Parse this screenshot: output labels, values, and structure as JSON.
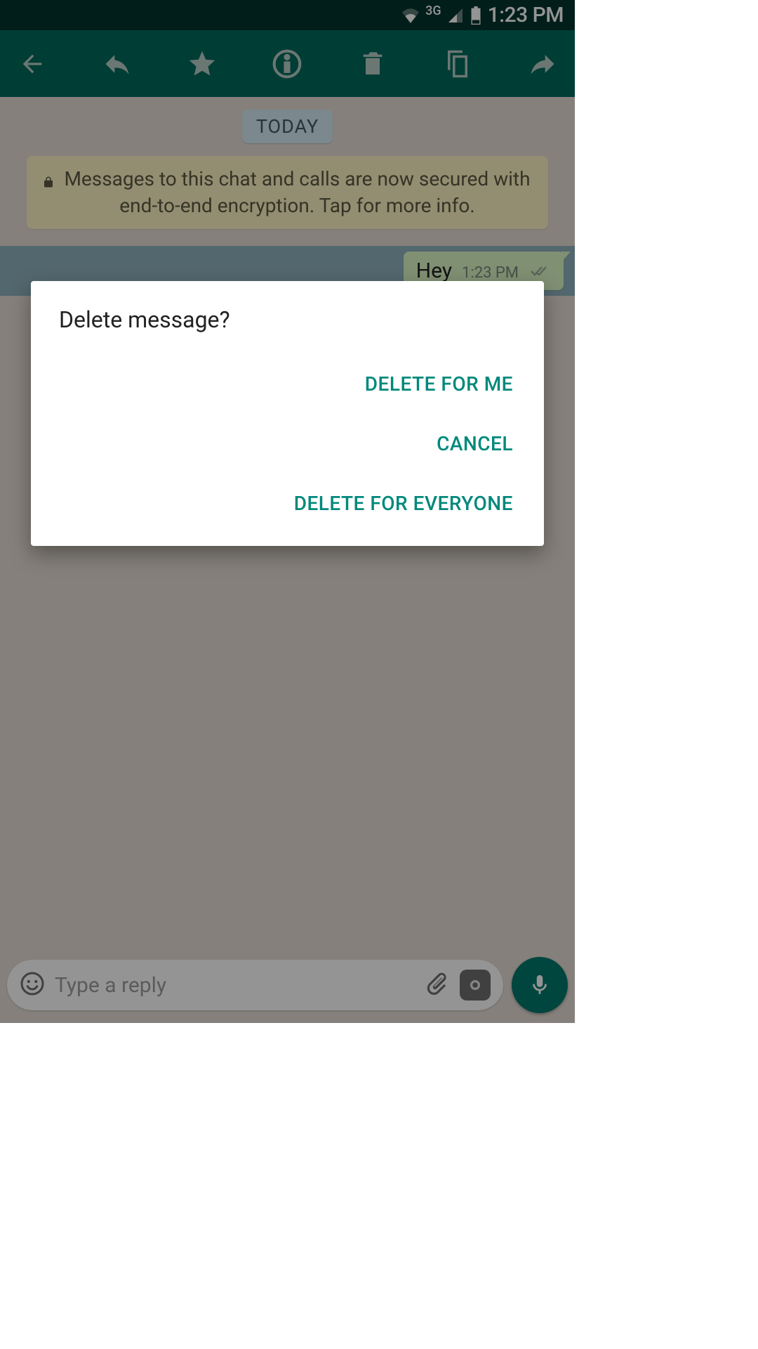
{
  "statusbar": {
    "network": "3G",
    "time": "1:23 PM"
  },
  "chat": {
    "day_label": "TODAY",
    "encryption_text": "Messages to this chat and calls are now secured with end-to-end encryption. Tap for more info.",
    "message": {
      "text": "Hey",
      "time": "1:23 PM"
    }
  },
  "input": {
    "placeholder": "Type a reply"
  },
  "dialog": {
    "title": "Delete message?",
    "delete_for_me": "DELETE FOR ME",
    "cancel": "CANCEL",
    "delete_for_everyone": "DELETE FOR EVERYONE"
  }
}
